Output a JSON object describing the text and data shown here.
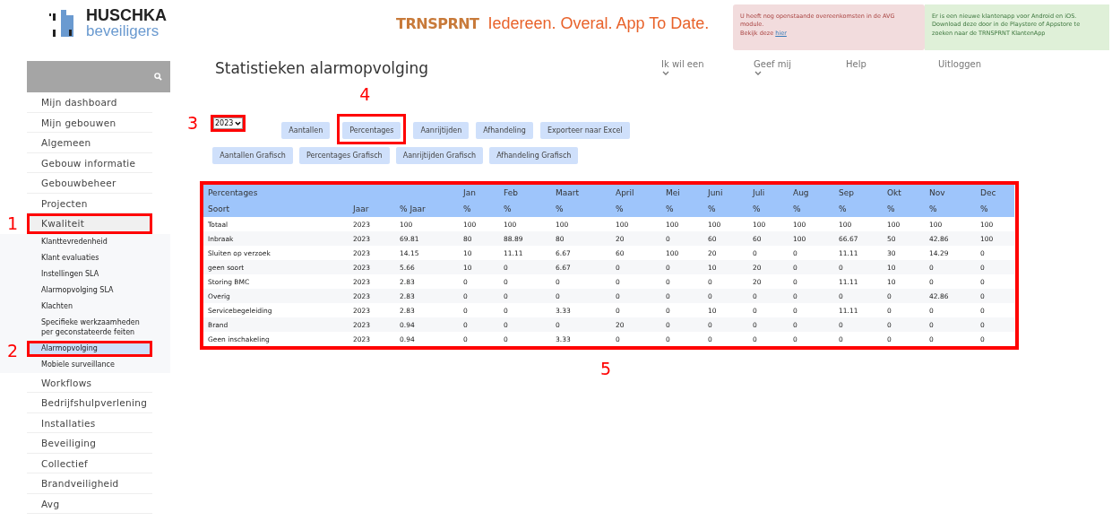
{
  "logo": {
    "name": "HUSCHKA",
    "subtitle": "beveiligers"
  },
  "banner": {
    "brand": "TRNSPRNT",
    "slogan": "Iedereen. Overal. App To Date."
  },
  "alerts": [
    {
      "kind": "danger",
      "lines": [
        "U heeft nog openstaande overeenkomsten in de AVG module.",
        "Bekijk deze"
      ],
      "link": "hier"
    },
    {
      "kind": "success",
      "lines": [
        "Er is een nieuwe klantenapp voor Android en iOS. Download deze door in de Playstore of Appstore te zoeken naar de TRNSPRNT KlantenApp"
      ]
    }
  ],
  "sidebar": {
    "items": [
      {
        "label": "Mijn dashboard",
        "selected": false
      },
      {
        "label": "Mijn gebouwen",
        "selected": false
      },
      {
        "label": "Algemeen",
        "selected": false
      },
      {
        "label": "Gebouw informatie",
        "selected": false
      },
      {
        "label": "Gebouwbeheer",
        "selected": false
      },
      {
        "label": "Projecten",
        "selected": false
      },
      {
        "label": "Kwaliteit",
        "selected": false,
        "expanded": true,
        "callout": "1",
        "children": [
          {
            "label": "Klanttevredenheid",
            "selected": false
          },
          {
            "label": "Klant evaluaties",
            "selected": false
          },
          {
            "label": "Instellingen SLA",
            "selected": false
          },
          {
            "label": "Alarmopvolging SLA",
            "selected": false
          },
          {
            "label": "Klachten",
            "selected": false
          },
          {
            "label": "Specifieke werkzaamheden per geconstateerde feiten",
            "selected": false
          },
          {
            "label": "Alarmopvolging",
            "selected": true,
            "callout": "2"
          },
          {
            "label": "Mobiele surveillance",
            "selected": false
          }
        ]
      },
      {
        "label": "Workflows",
        "selected": false
      },
      {
        "label": "Bedrijfshulpverlening",
        "selected": false
      },
      {
        "label": "Installaties",
        "selected": false
      },
      {
        "label": "Beveiliging",
        "selected": false
      },
      {
        "label": "Collectief",
        "selected": false
      },
      {
        "label": "Brandveiligheid",
        "selected": false
      },
      {
        "label": "Avg",
        "selected": false
      }
    ]
  },
  "page_title": "Statistieken alarmopvolging",
  "nav": [
    {
      "label": "Ik wil een",
      "dropdown": true
    },
    {
      "label": "Geef mij",
      "dropdown": true
    },
    {
      "label": "Help",
      "dropdown": false
    },
    {
      "label": "Uitloggen",
      "dropdown": false
    }
  ],
  "year_select": {
    "value": "2023",
    "callout": "3"
  },
  "buttons": [
    [
      {
        "label": "Aantallen"
      },
      {
        "label": "Percentages",
        "callout": "4"
      },
      {
        "label": "Aanrijtijden"
      },
      {
        "label": "Afhandeling"
      },
      {
        "label": "Exporteer naar Excel"
      }
    ],
    [
      {
        "label": "Aantallen Grafisch"
      },
      {
        "label": "Percentages Grafisch"
      },
      {
        "label": "Aanrijtijden Grafisch"
      },
      {
        "label": "Afhandeling Grafisch"
      }
    ]
  ],
  "table": {
    "callout": "5",
    "header_rows": [
      [
        "Percentages",
        "",
        "",
        "Jan",
        "Feb",
        "Maart",
        "April",
        "Mei",
        "Juni",
        "Juli",
        "Aug",
        "Sep",
        "Okt",
        "Nov",
        "Dec"
      ],
      [
        "Soort",
        "Jaar",
        "% Jaar",
        "%",
        "%",
        "%",
        "%",
        "%",
        "%",
        "%",
        "%",
        "%",
        "%",
        "%",
        "%"
      ]
    ],
    "rows": [
      [
        "Totaal",
        "2023",
        "100",
        "100",
        "100",
        "100",
        "100",
        "100",
        "100",
        "100",
        "100",
        "100",
        "100",
        "100",
        "100"
      ],
      [
        "Inbraak",
        "2023",
        "69.81",
        "80",
        "88.89",
        "80",
        "20",
        "0",
        "60",
        "60",
        "100",
        "66.67",
        "50",
        "42.86",
        "100"
      ],
      [
        "Sluiten op verzoek",
        "2023",
        "14.15",
        "10",
        "11.11",
        "6.67",
        "60",
        "100",
        "20",
        "0",
        "0",
        "11.11",
        "30",
        "14.29",
        "0"
      ],
      [
        "geen soort",
        "2023",
        "5.66",
        "10",
        "0",
        "6.67",
        "0",
        "0",
        "10",
        "20",
        "0",
        "0",
        "10",
        "0",
        "0"
      ],
      [
        "Storing BMC",
        "2023",
        "2.83",
        "0",
        "0",
        "0",
        "0",
        "0",
        "0",
        "20",
        "0",
        "11.11",
        "10",
        "0",
        "0"
      ],
      [
        "Overig",
        "2023",
        "2.83",
        "0",
        "0",
        "0",
        "0",
        "0",
        "0",
        "0",
        "0",
        "0",
        "0",
        "42.86",
        "0"
      ],
      [
        "Servicebegeleiding",
        "2023",
        "2.83",
        "0",
        "0",
        "3.33",
        "0",
        "0",
        "10",
        "0",
        "0",
        "11.11",
        "0",
        "0",
        "0"
      ],
      [
        "Brand",
        "2023",
        "0.94",
        "0",
        "0",
        "0",
        "20",
        "0",
        "0",
        "0",
        "0",
        "0",
        "0",
        "0",
        "0"
      ],
      [
        "Geen inschakeling",
        "2023",
        "0.94",
        "0",
        "0",
        "3.33",
        "0",
        "0",
        "0",
        "0",
        "0",
        "0",
        "0",
        "0",
        "0"
      ]
    ]
  }
}
